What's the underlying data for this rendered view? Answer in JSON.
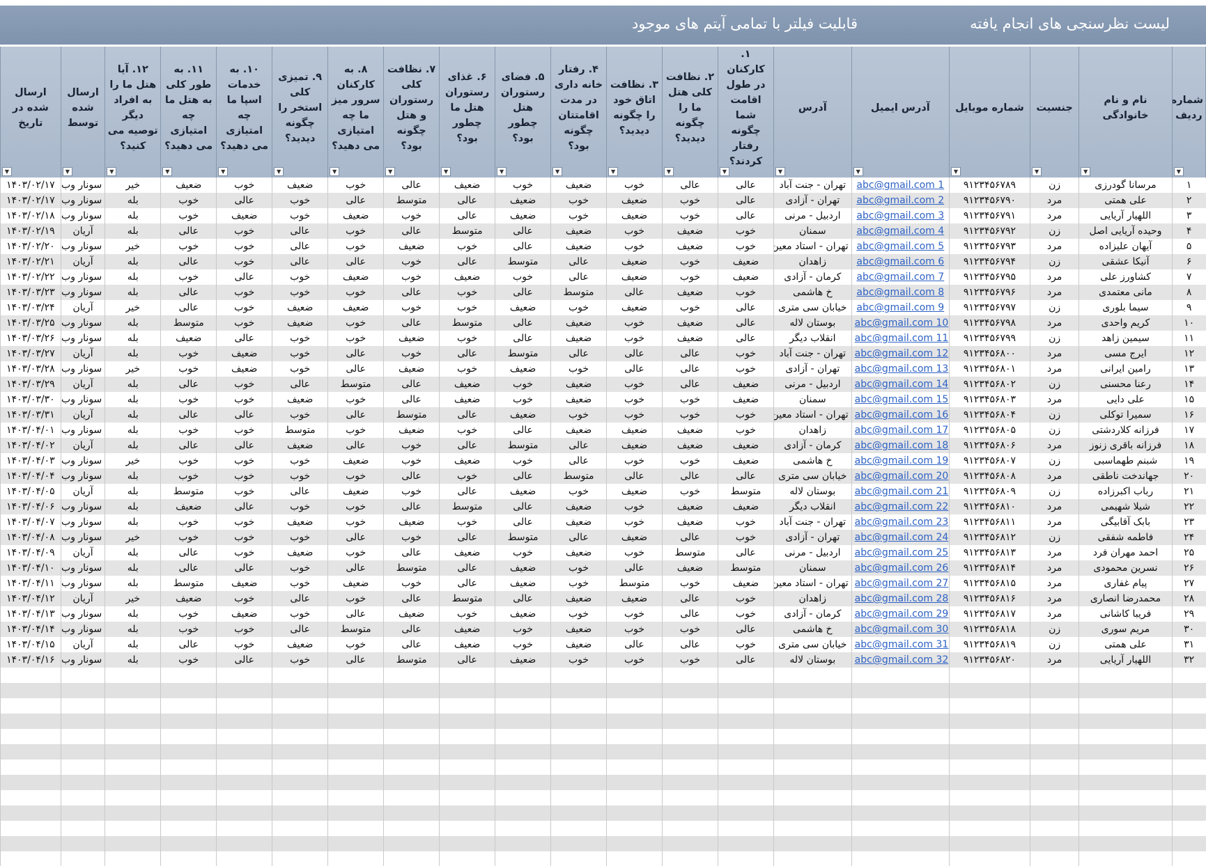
{
  "banner": {
    "title": "لیست نظرسنجی های انجام یافته",
    "subtitle": "قابلیت فیلتر با تمامی آیتم های موجود"
  },
  "columns": [
    "شماره ردیف",
    "نام و نام خانوادگی",
    "جنسیت",
    "شماره موبایل",
    "آدرس ایمیل",
    "آدرس",
    "۱. کارکنان در طول اقامت شما چگونه رفتار کردند؟",
    "۲. نظافت کلی هتل ما را چگونه دیدید؟",
    "۳. نظافت اتاق خود را چگونه دیدید؟",
    "۴. رفتار خانه داری در مدت اقامتتان چگونه بود؟",
    "۵. فضای رستوران هتل چطور بود؟",
    "۶. غذای رستوران هتل ما چطور بود؟",
    "۷. نظافت کلی رستوران و هتل چگونه بود؟",
    "۸. به کارکنان سرور میز ما چه امتیازی می دهید؟",
    "۹. تمیزی کلی استخر را چگونه دیدید؟",
    "۱۰. به خدمات اسپا ما چه امتیازی می دهید؟",
    "۱۱. به طور کلی به هتل ما چه امتیازی می دهید؟",
    "۱۲. آیا هتل ما را به افراد دیگر توصیه می کنید؟",
    "ارسال شده توسط",
    "ارسال شده در تاریخ"
  ],
  "rows": [
    [
      "۱",
      "مرسانا گودرزی",
      "زن",
      "۹۱۲۳۴۵۶۷۸۹",
      "abc@gmail.com 1",
      "تهران - جنت آباد",
      "عالی",
      "عالی",
      "خوب",
      "ضعیف",
      "خوب",
      "ضعیف",
      "عالی",
      "خوب",
      "ضعیف",
      "خوب",
      "ضعیف",
      "خیر",
      "سونار وب",
      "۱۴۰۳/۰۲/۱۷"
    ],
    [
      "۲",
      "علی همتی",
      "مرد",
      "۹۱۲۳۴۵۶۷۹۰",
      "abc@gmail.com 2",
      "تهران - آزادی",
      "عالی",
      "خوب",
      "ضعیف",
      "خوب",
      "ضعیف",
      "عالی",
      "متوسط",
      "عالی",
      "خوب",
      "عالی",
      "خوب",
      "بله",
      "سونار وب",
      "۱۴۰۳/۰۲/۱۷"
    ],
    [
      "۳",
      "اللهیار آریایی",
      "مرد",
      "۹۱۲۳۴۵۶۷۹۱",
      "abc@gmail.com 3",
      "اردبیل - مرنی",
      "عالی",
      "خوب",
      "ضعیف",
      "خوب",
      "ضعیف",
      "عالی",
      "خوب",
      "ضعیف",
      "خوب",
      "ضعیف",
      "خوب",
      "بله",
      "سونار وب",
      "۱۴۰۳/۰۲/۱۸"
    ],
    [
      "۴",
      "وحیده آریایی اصل",
      "زن",
      "۹۱۲۳۴۵۶۷۹۲",
      "abc@gmail.com 4",
      "سمنان",
      "خوب",
      "ضعیف",
      "خوب",
      "ضعیف",
      "عالی",
      "متوسط",
      "عالی",
      "خوب",
      "عالی",
      "خوب",
      "عالی",
      "بله",
      "آریان",
      "۱۴۰۳/۰۲/۱۹"
    ],
    [
      "۵",
      "آیهان علیزاده",
      "مرد",
      "۹۱۲۳۴۵۶۷۹۳",
      "abc@gmail.com 5",
      "تهران - استاد معین",
      "خوب",
      "ضعیف",
      "خوب",
      "ضعیف",
      "عالی",
      "خوب",
      "ضعیف",
      "خوب",
      "عالی",
      "خوب",
      "خوب",
      "خیر",
      "سونار وب",
      "۱۴۰۳/۰۲/۲۰"
    ],
    [
      "۶",
      "آنیکا عشقی",
      "زن",
      "۹۱۲۳۴۵۶۷۹۴",
      "abc@gmail.com 6",
      "زاهدان",
      "ضعیف",
      "خوب",
      "ضعیف",
      "عالی",
      "متوسط",
      "عالی",
      "خوب",
      "عالی",
      "عالی",
      "خوب",
      "عالی",
      "بله",
      "آریان",
      "۱۴۰۳/۰۲/۲۱"
    ],
    [
      "۷",
      "کشاورز علی",
      "مرد",
      "۹۱۲۳۴۵۶۷۹۵",
      "abc@gmail.com 7",
      "کرمان - آزادی",
      "ضعیف",
      "خوب",
      "ضعیف",
      "عالی",
      "خوب",
      "ضعیف",
      "خوب",
      "ضعیف",
      "خوب",
      "عالی",
      "خوب",
      "بله",
      "سونار وب",
      "۱۴۰۳/۰۲/۲۲"
    ],
    [
      "۸",
      "مانی معتمدی",
      "مرد",
      "۹۱۲۳۴۵۶۷۹۶",
      "abc@gmail.com 8",
      "خ هاشمی",
      "خوب",
      "ضعیف",
      "عالی",
      "متوسط",
      "عالی",
      "خوب",
      "عالی",
      "خوب",
      "خوب",
      "خوب",
      "عالی",
      "بله",
      "سونار وب",
      "۱۴۰۳/۰۳/۲۳"
    ],
    [
      "۹",
      "سیما بلوری",
      "زن",
      "۹۱۲۳۴۵۶۷۹۷",
      "abc@gmail.com 9",
      "خیابان سی متری",
      "عالی",
      "خوب",
      "ضعیف",
      "خوب",
      "ضعیف",
      "خوب",
      "خوب",
      "ضعیف",
      "ضعیف",
      "خوب",
      "عالی",
      "خیر",
      "آریان",
      "۱۴۰۳/۰۳/۲۴"
    ],
    [
      "۱۰",
      "کریم واحدی",
      "مرد",
      "۹۱۲۳۴۵۶۷۹۸",
      "abc@gmail.com 10",
      "بوستان لاله",
      "عالی",
      "ضعیف",
      "خوب",
      "ضعیف",
      "عالی",
      "متوسط",
      "عالی",
      "خوب",
      "ضعیف",
      "خوب",
      "متوسط",
      "بله",
      "سونار وب",
      "۱۴۰۳/۰۳/۲۵"
    ],
    [
      "۱۱",
      "سیمین زاهد",
      "زن",
      "۹۱۲۳۴۵۶۷۹۹",
      "abc@gmail.com 11",
      "انقلاب دیگر",
      "عالی",
      "ضعیف",
      "خوب",
      "ضعیف",
      "عالی",
      "خوب",
      "ضعیف",
      "خوب",
      "خوب",
      "عالی",
      "ضعیف",
      "بله",
      "سونار وب",
      "۱۴۰۳/۰۳/۲۶"
    ],
    [
      "۱۲",
      "ایرج مسی",
      "مرد",
      "۹۱۲۳۴۵۶۸۰۰",
      "abc@gmail.com 12",
      "تهران - جنت آباد",
      "خوب",
      "عالی",
      "عالی",
      "عالی",
      "متوسط",
      "عالی",
      "خوب",
      "عالی",
      "خوب",
      "ضعیف",
      "خوب",
      "بله",
      "آریان",
      "۱۴۰۳/۰۳/۲۷"
    ],
    [
      "۱۳",
      "رامین ایرانی",
      "مرد",
      "۹۱۲۳۴۵۶۸۰۱",
      "abc@gmail.com 13",
      "تهران - آزادی",
      "خوب",
      "عالی",
      "عالی",
      "خوب",
      "ضعیف",
      "خوب",
      "ضعیف",
      "عالی",
      "خوب",
      "ضعیف",
      "خوب",
      "خیر",
      "سونار وب",
      "۱۴۰۳/۰۳/۲۸"
    ],
    [
      "۱۴",
      "رعنا محسنی",
      "زن",
      "۹۱۲۳۴۵۶۸۰۲",
      "abc@gmail.com 14",
      "اردبیل - مرنی",
      "ضعیف",
      "عالی",
      "خوب",
      "ضعیف",
      "خوب",
      "ضعیف",
      "عالی",
      "متوسط",
      "عالی",
      "خوب",
      "عالی",
      "بله",
      "آریان",
      "۱۴۰۳/۰۳/۲۹"
    ],
    [
      "۱۵",
      "علی دایی",
      "مرد",
      "۹۱۲۳۴۵۶۸۰۳",
      "abc@gmail.com 15",
      "سمنان",
      "ضعیف",
      "خوب",
      "خوب",
      "ضعیف",
      "خوب",
      "ضعیف",
      "عالی",
      "خوب",
      "ضعیف",
      "خوب",
      "خوب",
      "بله",
      "سونار وب",
      "۱۴۰۳/۰۳/۳۰"
    ],
    [
      "۱۶",
      "سمیرا توکلی",
      "زن",
      "۹۱۲۳۴۵۶۸۰۴",
      "abc@gmail.com 16",
      "تهران - استاد معین",
      "خوب",
      "خوب",
      "خوب",
      "خوب",
      "ضعیف",
      "عالی",
      "متوسط",
      "عالی",
      "خوب",
      "عالی",
      "عالی",
      "بله",
      "آریان",
      "۱۴۰۳/۰۳/۳۱"
    ],
    [
      "۱۷",
      "فرزانه کلاردشتی",
      "زن",
      "۹۱۲۳۴۵۶۸۰۵",
      "abc@gmail.com 17",
      "زاهدان",
      "خوب",
      "ضعیف",
      "ضعیف",
      "ضعیف",
      "عالی",
      "خوب",
      "ضعیف",
      "خوب",
      "متوسط",
      "خوب",
      "خوب",
      "بله",
      "سونار وب",
      "۱۴۰۳/۰۴/۰۱"
    ],
    [
      "۱۸",
      "فرزانه باقری زنوز",
      "مرد",
      "۹۱۲۳۴۵۶۸۰۶",
      "abc@gmail.com 18",
      "کرمان - آزادی",
      "ضعیف",
      "ضعیف",
      "ضعیف",
      "عالی",
      "متوسط",
      "عالی",
      "خوب",
      "عالی",
      "ضعیف",
      "عالی",
      "عالی",
      "بله",
      "آریان",
      "۱۴۰۳/۰۴/۰۲"
    ],
    [
      "۱۹",
      "شبنم طهماسبی",
      "زن",
      "۹۱۲۳۴۵۶۸۰۷",
      "abc@gmail.com 19",
      "خ هاشمی",
      "ضعیف",
      "خوب",
      "خوب",
      "عالی",
      "خوب",
      "ضعیف",
      "خوب",
      "ضعیف",
      "خوب",
      "خوب",
      "خوب",
      "خیر",
      "سونار وب",
      "۱۴۰۳/۰۴/۰۳"
    ],
    [
      "۲۰",
      "جهاندخت ناطقی",
      "مرد",
      "۹۱۲۳۴۵۶۸۰۸",
      "abc@gmail.com 20",
      "خیابان سی متری",
      "عالی",
      "عالی",
      "عالی",
      "متوسط",
      "عالی",
      "خوب",
      "عالی",
      "خوب",
      "خوب",
      "خوب",
      "خوب",
      "بله",
      "سونار وب",
      "۱۴۰۳/۰۴/۰۴"
    ],
    [
      "۲۱",
      "رباب اکبرزاده",
      "زن",
      "۹۱۲۳۴۵۶۸۰۹",
      "abc@gmail.com 21",
      "بوستان لاله",
      "متوسط",
      "خوب",
      "ضعیف",
      "خوب",
      "ضعیف",
      "عالی",
      "خوب",
      "ضعیف",
      "عالی",
      "خوب",
      "متوسط",
      "بله",
      "آریان",
      "۱۴۰۳/۰۴/۰۵"
    ],
    [
      "۲۲",
      "شیلا شهیمی",
      "مرد",
      "۹۱۲۳۴۵۶۸۱۰",
      "abc@gmail.com 22",
      "انقلاب دیگر",
      "ضعیف",
      "ضعیف",
      "خوب",
      "ضعیف",
      "عالی",
      "متوسط",
      "عالی",
      "خوب",
      "خوب",
      "عالی",
      "ضعیف",
      "بله",
      "سونار وب",
      "۱۴۰۳/۰۴/۰۶"
    ],
    [
      "۲۳",
      "بابک آقابیگی",
      "مرد",
      "۹۱۲۳۴۵۶۸۱۱",
      "abc@gmail.com 23",
      "تهران - جنت آباد",
      "خوب",
      "ضعیف",
      "خوب",
      "ضعیف",
      "عالی",
      "خوب",
      "ضعیف",
      "خوب",
      "ضعیف",
      "خوب",
      "خوب",
      "بله",
      "سونار وب",
      "۱۴۰۳/۰۴/۰۷"
    ],
    [
      "۲۴",
      "فاطمه شفقی",
      "زن",
      "۹۱۲۳۴۵۶۸۱۲",
      "abc@gmail.com 24",
      "تهران - آزادی",
      "خوب",
      "عالی",
      "ضعیف",
      "عالی",
      "متوسط",
      "عالی",
      "خوب",
      "عالی",
      "خوب",
      "خوب",
      "خوب",
      "خیر",
      "سونار وب",
      "۱۴۰۳/۰۴/۰۸"
    ],
    [
      "۲۵",
      "احمد مهران فرد",
      "مرد",
      "۹۱۲۳۴۵۶۸۱۳",
      "abc@gmail.com 25",
      "اردبیل - مرنی",
      "عالی",
      "متوسط",
      "خوب",
      "ضعیف",
      "خوب",
      "ضعیف",
      "عالی",
      "خوب",
      "ضعیف",
      "خوب",
      "عالی",
      "بله",
      "آریان",
      "۱۴۰۳/۰۴/۰۹"
    ],
    [
      "۲۶",
      "نسرین محمودی",
      "مرد",
      "۹۱۲۳۴۵۶۸۱۴",
      "abc@gmail.com 26",
      "سمنان",
      "متوسط",
      "ضعیف",
      "عالی",
      "خوب",
      "ضعیف",
      "عالی",
      "متوسط",
      "عالی",
      "خوب",
      "عالی",
      "عالی",
      "بله",
      "سونار وب",
      "۱۴۰۳/۰۴/۱۰"
    ],
    [
      "۲۷",
      "پیام غفاری",
      "مرد",
      "۹۱۲۳۴۵۶۸۱۵",
      "abc@gmail.com 27",
      "تهران - استاد معین",
      "ضعیف",
      "خوب",
      "متوسط",
      "خوب",
      "ضعیف",
      "عالی",
      "خوب",
      "ضعیف",
      "خوب",
      "ضعیف",
      "متوسط",
      "بله",
      "سونار وب",
      "۱۴۰۳/۰۴/۱۱"
    ],
    [
      "۲۸",
      "محمدرضا انصاری",
      "مرد",
      "۹۱۲۳۴۵۶۸۱۶",
      "abc@gmail.com 28",
      "زاهدان",
      "خوب",
      "عالی",
      "ضعیف",
      "ضعیف",
      "عالی",
      "متوسط",
      "عالی",
      "خوب",
      "عالی",
      "خوب",
      "ضعیف",
      "خیر",
      "آریان",
      "۱۴۰۳/۰۴/۱۲"
    ],
    [
      "۲۹",
      "فریبا کاشانی",
      "مرد",
      "۹۱۲۳۴۵۶۸۱۷",
      "abc@gmail.com 29",
      "کرمان - آزادی",
      "خوب",
      "عالی",
      "خوب",
      "خوب",
      "ضعیف",
      "خوب",
      "ضعیف",
      "عالی",
      "خوب",
      "ضعیف",
      "خوب",
      "بله",
      "سونار وب",
      "۱۴۰۳/۰۴/۱۳"
    ],
    [
      "۳۰",
      "مریم سوری",
      "زن",
      "۹۱۲۳۴۵۶۸۱۸",
      "abc@gmail.com 30",
      "خ هاشمی",
      "عالی",
      "خوب",
      "خوب",
      "ضعیف",
      "خوب",
      "ضعیف",
      "عالی",
      "متوسط",
      "عالی",
      "خوب",
      "خوب",
      "بله",
      "سونار وب",
      "۱۴۰۳/۰۴/۱۴"
    ],
    [
      "۳۱",
      "علی همتی",
      "زن",
      "۹۱۲۳۴۵۶۸۱۹",
      "abc@gmail.com 31",
      "خیابان سی متری",
      "خوب",
      "عالی",
      "عالی",
      "ضعیف",
      "خوب",
      "ضعیف",
      "عالی",
      "خوب",
      "ضعیف",
      "خوب",
      "عالی",
      "بله",
      "آریان",
      "۱۴۰۳/۰۴/۱۵"
    ],
    [
      "۳۲",
      "اللهیار آریایی",
      "مرد",
      "۹۱۲۳۴۵۶۸۲۰",
      "abc@gmail.com 32",
      "بوستان لاله",
      "عالی",
      "خوب",
      "خوب",
      "خوب",
      "ضعیف",
      "عالی",
      "متوسط",
      "عالی",
      "خوب",
      "عالی",
      "خوب",
      "بله",
      "سونار وب",
      "۱۴۰۳/۰۴/۱۶"
    ]
  ],
  "icons": {
    "filter": "filter-dropdown-icon"
  },
  "colors": {
    "banner": "#8ea0b8",
    "header": "#b2c0d2",
    "link": "#2e62c4",
    "stripe": "#e4e4e4"
  }
}
